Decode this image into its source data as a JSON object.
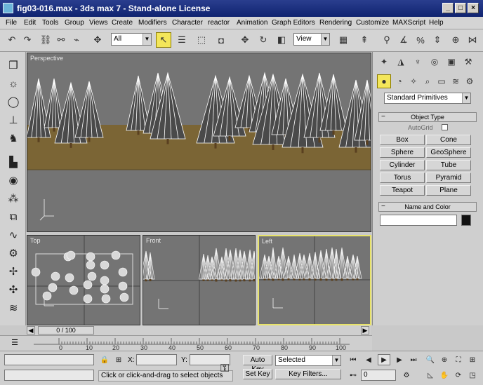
{
  "window": {
    "title": "fig03-016.max - 3ds max 7 - Stand-alone License"
  },
  "menu": [
    "File",
    "Edit",
    "Tools",
    "Group",
    "Views",
    "Create",
    "Modifiers",
    "Character",
    "reactor",
    "Animation",
    "Graph Editors",
    "Rendering",
    "Customize",
    "MAXScript",
    "Help"
  ],
  "toolbar": {
    "selection_filter": "All",
    "ref_coord": "View"
  },
  "viewports": {
    "perspective": "Perspective",
    "top": "Top",
    "front": "Front",
    "left": "Left"
  },
  "command_panel": {
    "category_dropdown": "Standard Primitives",
    "object_type_title": "Object Type",
    "autogrid_label": "AutoGrid",
    "buttons": [
      "Box",
      "Cone",
      "Sphere",
      "GeoSphere",
      "Cylinder",
      "Tube",
      "Torus",
      "Pyramid",
      "Teapot",
      "Plane"
    ],
    "name_color_title": "Name and Color"
  },
  "timeline": {
    "slider_label": "0 / 100",
    "ticks": [
      "0",
      "10",
      "20",
      "30",
      "40",
      "50",
      "60",
      "70",
      "80",
      "90",
      "100"
    ]
  },
  "status": {
    "x_label": "X:",
    "y_label": "Y:",
    "prompt": "Click or click-and-drag to select objects",
    "auto_key": "Auto Key",
    "set_key": "Set Key",
    "key_mode": "Selected",
    "key_filters": "Key Filters...",
    "frame": "0"
  },
  "colors": {
    "title_bar": "#0f2370",
    "viewport_bg": "#747474",
    "ground": "#7b6535",
    "active_border": "#e8e36a"
  }
}
